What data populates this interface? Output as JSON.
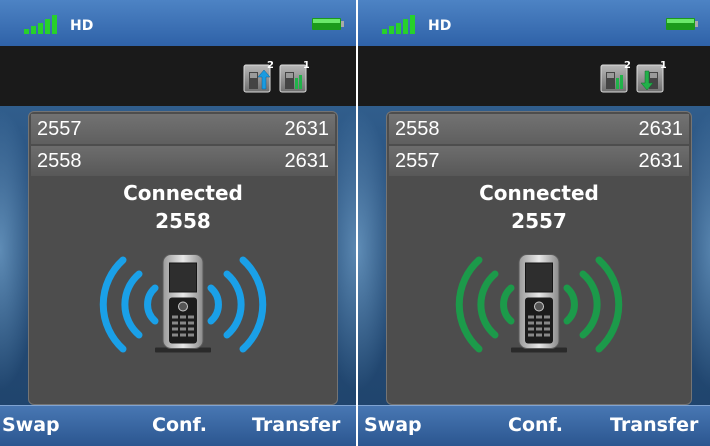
{
  "screens": [
    {
      "status": {
        "network_label": "HD"
      },
      "calls": {
        "held": {
          "number": "2557",
          "own": "2631"
        },
        "active": {
          "number": "2558",
          "own": "2631"
        }
      },
      "state_text": "Connected",
      "connected_number": "2558",
      "call_icons": [
        {
          "icon": "outgoing-call-icon",
          "badge": "2"
        },
        {
          "icon": "held-call-icon",
          "badge": "1"
        }
      ],
      "wave_color": "#1aa0e8",
      "softkeys": {
        "left": "Swap",
        "middle": "Conf.",
        "right": "Transfer"
      }
    },
    {
      "status": {
        "network_label": "HD"
      },
      "calls": {
        "held": {
          "number": "2558",
          "own": "2631"
        },
        "active": {
          "number": "2557",
          "own": "2631"
        }
      },
      "state_text": "Connected",
      "connected_number": "2557",
      "call_icons": [
        {
          "icon": "held-call-icon",
          "badge": "2"
        },
        {
          "icon": "incoming-call-icon",
          "badge": "1"
        }
      ],
      "wave_color": "#1c9a4a",
      "softkeys": {
        "left": "Swap",
        "middle": "Conf.",
        "right": "Transfer"
      }
    }
  ]
}
